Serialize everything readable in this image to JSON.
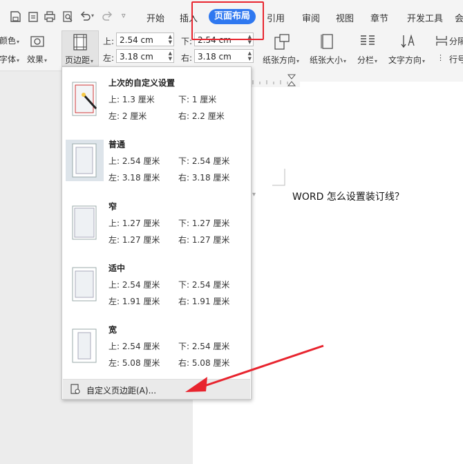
{
  "tabs": {
    "start": "开始",
    "insert": "插入",
    "page_layout": "页面布局",
    "references": "引用",
    "review": "审阅",
    "view": "视图",
    "chapter": "章节",
    "developer": "开发工具",
    "member": "会"
  },
  "ribbon": {
    "color": "颜色",
    "font": "字体",
    "effects": "效果",
    "margins": "页边距",
    "top_label": "上:",
    "bottom_label": "下:",
    "left_label": "左:",
    "right_label": "右:",
    "top_value": "2.54 cm",
    "bottom_value": "2.54 cm",
    "left_value": "3.18 cm",
    "right_value": "3.18 cm",
    "orientation": "纸张方向",
    "size": "纸张大小",
    "columns": "分栏",
    "text_direction": "文字方向",
    "separator": "分隔",
    "line_number": "行号"
  },
  "menu": {
    "presets": [
      {
        "title": "上次的自定义设置",
        "top": "上: 1.3 厘米",
        "bottom": "下: 1 厘米",
        "left": "左: 2 厘米",
        "right": "右: 2.2 厘米"
      },
      {
        "title": "普通",
        "top": "上: 2.54 厘米",
        "bottom": "下: 2.54 厘米",
        "left": "左: 3.18 厘米",
        "right": "右: 3.18 厘米"
      },
      {
        "title": "窄",
        "top": "上: 1.27 厘米",
        "bottom": "下: 1.27 厘米",
        "left": "左: 1.27 厘米",
        "right": "右: 1.27 厘米"
      },
      {
        "title": "适中",
        "top": "上: 2.54 厘米",
        "bottom": "下: 2.54 厘米",
        "left": "左: 1.91 厘米",
        "right": "右: 1.91 厘米"
      },
      {
        "title": "宽",
        "top": "上: 2.54 厘米",
        "bottom": "下: 2.54 厘米",
        "left": "左: 5.08 厘米",
        "right": "右: 5.08 厘米"
      }
    ],
    "custom": "自定义页边距(A)..."
  },
  "document": {
    "heading": "WORD 怎么设置装订线？"
  },
  "colors": {
    "accent": "#2f78f0",
    "highlight": "#e8242e"
  }
}
